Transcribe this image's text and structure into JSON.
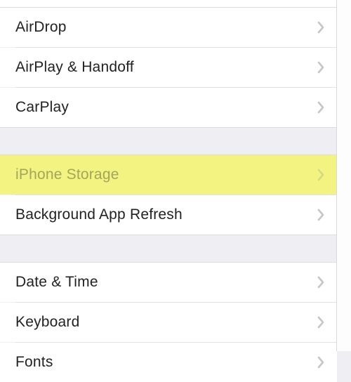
{
  "groups": {
    "g1": {
      "items": [
        {
          "label": "AirDrop"
        },
        {
          "label": "AirPlay & Handoff"
        },
        {
          "label": "CarPlay"
        }
      ]
    },
    "g2": {
      "items": [
        {
          "label": "iPhone Storage",
          "highlight": true
        },
        {
          "label": "Background App Refresh"
        }
      ]
    },
    "g3": {
      "items": [
        {
          "label": "Date & Time"
        },
        {
          "label": "Keyboard"
        },
        {
          "label": "Fonts"
        }
      ]
    }
  }
}
